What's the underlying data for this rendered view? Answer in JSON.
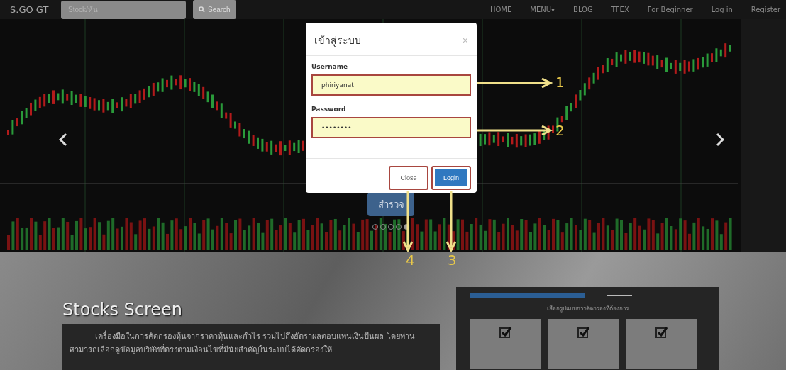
{
  "navbar": {
    "logo": "S.GO GT",
    "search": {
      "placeholder": "Stock/หุ้น"
    },
    "search_button": "Search",
    "links": [
      {
        "label": "HOME"
      },
      {
        "label": "MENU▾"
      },
      {
        "label": "BLOG"
      },
      {
        "label": "TFEX"
      },
      {
        "label": "For Beginner"
      },
      {
        "label": "Log in"
      },
      {
        "label": "Register"
      }
    ]
  },
  "carousel": {
    "button": "สำรวจ",
    "dots": [
      {
        "selected": false
      },
      {
        "selected": false
      },
      {
        "selected": false
      },
      {
        "selected": false
      },
      {
        "selected": true
      }
    ]
  },
  "login_modal": {
    "title": "เข้าสู่ระบบ",
    "close_icon": "×",
    "fields": [
      {
        "label": "Username",
        "value": "phiriyanat"
      },
      {
        "label": "Password",
        "value": "••••••••"
      }
    ],
    "buttons": [
      {
        "label": "Close",
        "kind": "default"
      },
      {
        "label": "Login",
        "kind": "primary"
      }
    ]
  },
  "annotations": [
    "1",
    "2",
    "3",
    "4"
  ],
  "stocks_screen": {
    "title": "Stocks Screen",
    "description": "เครื่องมือในการคัดกรองหุ้นจากราคาหุ้นและกำไร รวมไปถึงอัตราผลตอบแทนเงินปันผล โดยท่านสามารถเลือกดูข้อมูลบริษัทที่ตรงตามเงื่อนไขที่มีนัยสำคัญในระบบได้คัดกรองให้"
  },
  "screen_panel": {
    "tabs": [
      {
        "selected": true
      },
      {
        "selected": false
      }
    ],
    "caption": "เลือกรูปแบบการคัดกรองที่ต้องการ",
    "cards": [
      {
        "checked": true
      },
      {
        "checked": true
      },
      {
        "checked": true
      }
    ]
  }
}
